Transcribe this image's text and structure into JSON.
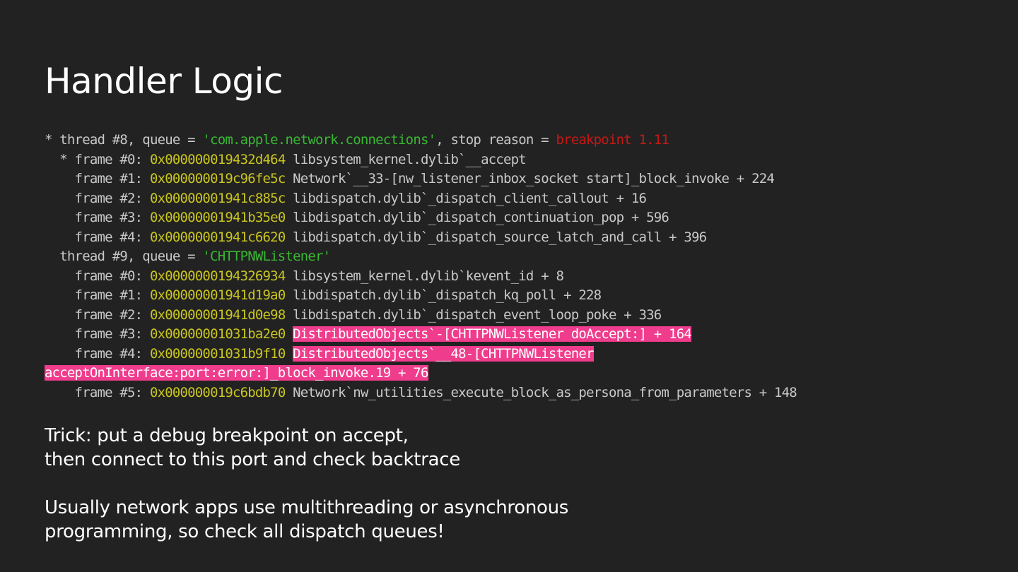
{
  "slide": {
    "title": "Handler Logic",
    "trick_lines": [
      "Trick: put a debug breakpoint on accept,",
      "then connect to this port and check backtrace"
    ],
    "usually_lines": [
      "Usually network apps use multithreading or asynchronous",
      "programming, so check all dispatch queues!"
    ]
  },
  "colors": {
    "background": "#222222",
    "address": "#c9c51f",
    "string": "#38b832",
    "stop_reason": "#c41a16",
    "highlight": "#f03c8c"
  },
  "backtrace": {
    "thread8": {
      "prefix": "* thread #8, queue = ",
      "queue": "'com.apple.network.connections'",
      "middle": ", stop reason = ",
      "reason": "breakpoint 1.11"
    },
    "t8f0": {
      "prefix": "  * frame #0: ",
      "addr": "0x000000019432d464",
      "text": " libsystem_kernel.dylib`__accept"
    },
    "t8f1": {
      "prefix": "    frame #1: ",
      "addr": "0x000000019c96fe5c",
      "text": " Network`__33-[nw_listener_inbox_socket start]_block_invoke + 224"
    },
    "t8f2": {
      "prefix": "    frame #2: ",
      "addr": "0x00000001941c885c",
      "text": " libdispatch.dylib`_dispatch_client_callout + 16"
    },
    "t8f3": {
      "prefix": "    frame #3: ",
      "addr": "0x00000001941b35e0",
      "text": " libdispatch.dylib`_dispatch_continuation_pop + 596"
    },
    "t8f4": {
      "prefix": "    frame #4: ",
      "addr": "0x00000001941c6620",
      "text": " libdispatch.dylib`_dispatch_source_latch_and_call + 396"
    },
    "thread9": {
      "prefix": "  thread #9, queue = ",
      "queue": "'CHTTPNWListener'"
    },
    "t9f0": {
      "prefix": "    frame #0: ",
      "addr": "0x0000000194326934",
      "text": " libsystem_kernel.dylib`kevent_id + 8"
    },
    "t9f1": {
      "prefix": "    frame #1: ",
      "addr": "0x00000001941d19a0",
      "text": " libdispatch.dylib`_dispatch_kq_poll + 228"
    },
    "t9f2": {
      "prefix": "    frame #2: ",
      "addr": "0x00000001941d0e98",
      "text": " libdispatch.dylib`_dispatch_event_loop_poke + 336"
    },
    "t9f3": {
      "prefix": "    frame #3: ",
      "addr": "0x00000001031ba2e0",
      "sep": " ",
      "highlight": "DistributedObjects`-[CHTTPNWListener doAccept:] + 164"
    },
    "t9f4": {
      "prefix": "    frame #4: ",
      "addr": "0x00000001031b9f10",
      "sep": " ",
      "highlight_a": "DistributedObjects`__48-[CHTTPNWListener",
      "highlight_b": "acceptOnInterface:port:error:]_block_invoke.19 + 76"
    },
    "t9f5": {
      "prefix": "    frame #5: ",
      "addr": "0x000000019c6bdb70",
      "text": " Network`nw_utilities_execute_block_as_persona_from_parameters + 148"
    }
  }
}
